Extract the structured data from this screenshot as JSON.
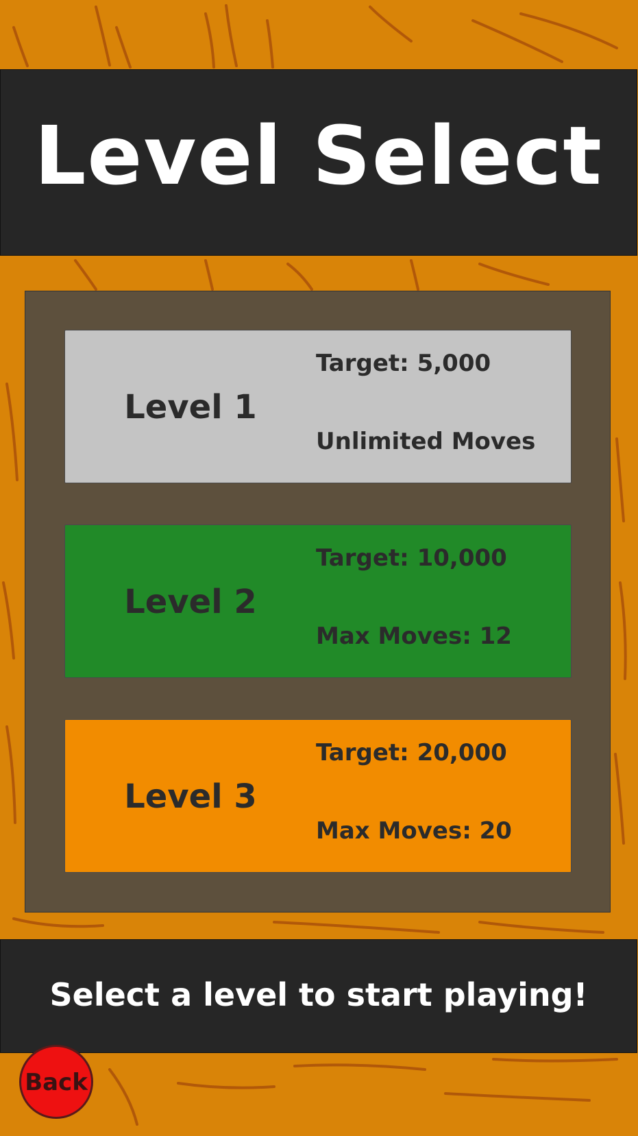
{
  "header": {
    "title": "Level Select"
  },
  "levels": [
    {
      "name": "Level 1",
      "target": "Target: 5,000",
      "moves": "Unlimited Moves",
      "color": "#c4c4c4"
    },
    {
      "name": "Level 2",
      "target": "Target: 10,000",
      "moves": "Max Moves: 12",
      "color": "#218a28"
    },
    {
      "name": "Level 3",
      "target": "Target: 20,000",
      "moves": "Max Moves: 20",
      "color": "#f28c00"
    }
  ],
  "footer": {
    "message": "Select a level to start playing!"
  },
  "back_button": {
    "label": "Back",
    "color": "#ee1111"
  },
  "colors": {
    "background": "#d98408",
    "bars": "#262626",
    "panel": "#464646"
  }
}
